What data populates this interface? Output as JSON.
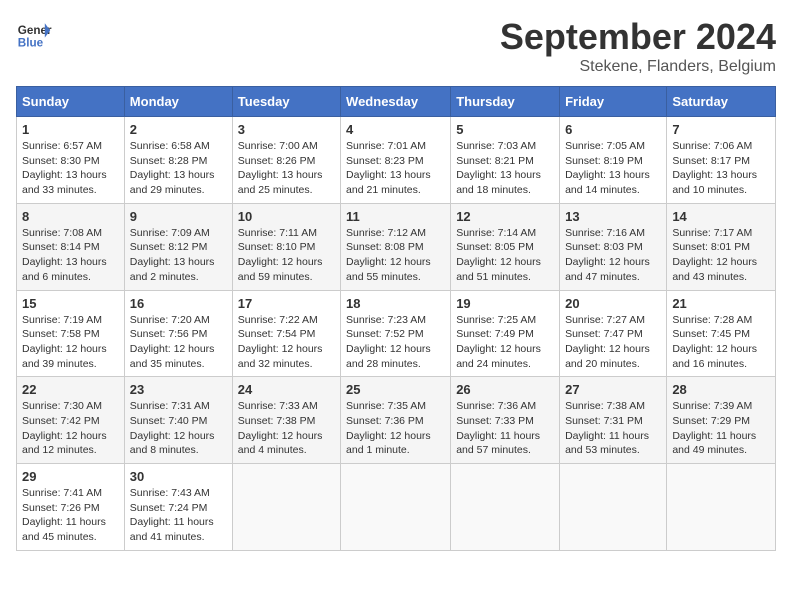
{
  "header": {
    "logo_line1": "General",
    "logo_line2": "Blue",
    "month_title": "September 2024",
    "subtitle": "Stekene, Flanders, Belgium"
  },
  "weekdays": [
    "Sunday",
    "Monday",
    "Tuesday",
    "Wednesday",
    "Thursday",
    "Friday",
    "Saturday"
  ],
  "weeks": [
    [
      {
        "day": "1",
        "info": "Sunrise: 6:57 AM\nSunset: 8:30 PM\nDaylight: 13 hours\nand 33 minutes."
      },
      {
        "day": "2",
        "info": "Sunrise: 6:58 AM\nSunset: 8:28 PM\nDaylight: 13 hours\nand 29 minutes."
      },
      {
        "day": "3",
        "info": "Sunrise: 7:00 AM\nSunset: 8:26 PM\nDaylight: 13 hours\nand 25 minutes."
      },
      {
        "day": "4",
        "info": "Sunrise: 7:01 AM\nSunset: 8:23 PM\nDaylight: 13 hours\nand 21 minutes."
      },
      {
        "day": "5",
        "info": "Sunrise: 7:03 AM\nSunset: 8:21 PM\nDaylight: 13 hours\nand 18 minutes."
      },
      {
        "day": "6",
        "info": "Sunrise: 7:05 AM\nSunset: 8:19 PM\nDaylight: 13 hours\nand 14 minutes."
      },
      {
        "day": "7",
        "info": "Sunrise: 7:06 AM\nSunset: 8:17 PM\nDaylight: 13 hours\nand 10 minutes."
      }
    ],
    [
      {
        "day": "8",
        "info": "Sunrise: 7:08 AM\nSunset: 8:14 PM\nDaylight: 13 hours\nand 6 minutes."
      },
      {
        "day": "9",
        "info": "Sunrise: 7:09 AM\nSunset: 8:12 PM\nDaylight: 13 hours\nand 2 minutes."
      },
      {
        "day": "10",
        "info": "Sunrise: 7:11 AM\nSunset: 8:10 PM\nDaylight: 12 hours\nand 59 minutes."
      },
      {
        "day": "11",
        "info": "Sunrise: 7:12 AM\nSunset: 8:08 PM\nDaylight: 12 hours\nand 55 minutes."
      },
      {
        "day": "12",
        "info": "Sunrise: 7:14 AM\nSunset: 8:05 PM\nDaylight: 12 hours\nand 51 minutes."
      },
      {
        "day": "13",
        "info": "Sunrise: 7:16 AM\nSunset: 8:03 PM\nDaylight: 12 hours\nand 47 minutes."
      },
      {
        "day": "14",
        "info": "Sunrise: 7:17 AM\nSunset: 8:01 PM\nDaylight: 12 hours\nand 43 minutes."
      }
    ],
    [
      {
        "day": "15",
        "info": "Sunrise: 7:19 AM\nSunset: 7:58 PM\nDaylight: 12 hours\nand 39 minutes."
      },
      {
        "day": "16",
        "info": "Sunrise: 7:20 AM\nSunset: 7:56 PM\nDaylight: 12 hours\nand 35 minutes."
      },
      {
        "day": "17",
        "info": "Sunrise: 7:22 AM\nSunset: 7:54 PM\nDaylight: 12 hours\nand 32 minutes."
      },
      {
        "day": "18",
        "info": "Sunrise: 7:23 AM\nSunset: 7:52 PM\nDaylight: 12 hours\nand 28 minutes."
      },
      {
        "day": "19",
        "info": "Sunrise: 7:25 AM\nSunset: 7:49 PM\nDaylight: 12 hours\nand 24 minutes."
      },
      {
        "day": "20",
        "info": "Sunrise: 7:27 AM\nSunset: 7:47 PM\nDaylight: 12 hours\nand 20 minutes."
      },
      {
        "day": "21",
        "info": "Sunrise: 7:28 AM\nSunset: 7:45 PM\nDaylight: 12 hours\nand 16 minutes."
      }
    ],
    [
      {
        "day": "22",
        "info": "Sunrise: 7:30 AM\nSunset: 7:42 PM\nDaylight: 12 hours\nand 12 minutes."
      },
      {
        "day": "23",
        "info": "Sunrise: 7:31 AM\nSunset: 7:40 PM\nDaylight: 12 hours\nand 8 minutes."
      },
      {
        "day": "24",
        "info": "Sunrise: 7:33 AM\nSunset: 7:38 PM\nDaylight: 12 hours\nand 4 minutes."
      },
      {
        "day": "25",
        "info": "Sunrise: 7:35 AM\nSunset: 7:36 PM\nDaylight: 12 hours\nand 1 minute."
      },
      {
        "day": "26",
        "info": "Sunrise: 7:36 AM\nSunset: 7:33 PM\nDaylight: 11 hours\nand 57 minutes."
      },
      {
        "day": "27",
        "info": "Sunrise: 7:38 AM\nSunset: 7:31 PM\nDaylight: 11 hours\nand 53 minutes."
      },
      {
        "day": "28",
        "info": "Sunrise: 7:39 AM\nSunset: 7:29 PM\nDaylight: 11 hours\nand 49 minutes."
      }
    ],
    [
      {
        "day": "29",
        "info": "Sunrise: 7:41 AM\nSunset: 7:26 PM\nDaylight: 11 hours\nand 45 minutes."
      },
      {
        "day": "30",
        "info": "Sunrise: 7:43 AM\nSunset: 7:24 PM\nDaylight: 11 hours\nand 41 minutes."
      },
      {
        "day": "",
        "info": ""
      },
      {
        "day": "",
        "info": ""
      },
      {
        "day": "",
        "info": ""
      },
      {
        "day": "",
        "info": ""
      },
      {
        "day": "",
        "info": ""
      }
    ]
  ]
}
